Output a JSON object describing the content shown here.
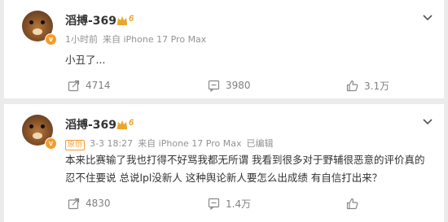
{
  "posts": [
    {
      "username": "滔搏-369",
      "vip_level": "6",
      "meta_time": "1小时前",
      "meta_source": "来自 iPhone 17 Pro Max",
      "body": "小丑了...",
      "counts": {
        "forward": "4714",
        "comment": "3980",
        "like": "3.1万"
      }
    },
    {
      "username": "滔搏-369",
      "vip_level": "6",
      "tag": "原创",
      "meta_time": "3-3 18:27",
      "meta_source": "来自 iPhone 17 Pro Max",
      "meta_edited": "已编辑",
      "body": "本来比赛输了我也打得不好骂我都无所谓  我看到很多对于野辅很恶意的评价真的忍不住要说 总说lpl没新人 这种舆论新人要怎么出成绩 有自信打出来？",
      "counts": {
        "forward": "4830",
        "comment": "1.4万",
        "like": ""
      }
    }
  ],
  "icons": {
    "verified": "verified-badge-icon",
    "crown": "crown-icon",
    "more": "chevron-down-icon",
    "forward": "share-icon",
    "comment": "comment-icon",
    "like": "thumbs-up-icon"
  },
  "colors": {
    "background": "#ebebeb",
    "card": "#ffffff",
    "accent": "#f29d2c",
    "meta": "#939393",
    "text": "#333333"
  }
}
